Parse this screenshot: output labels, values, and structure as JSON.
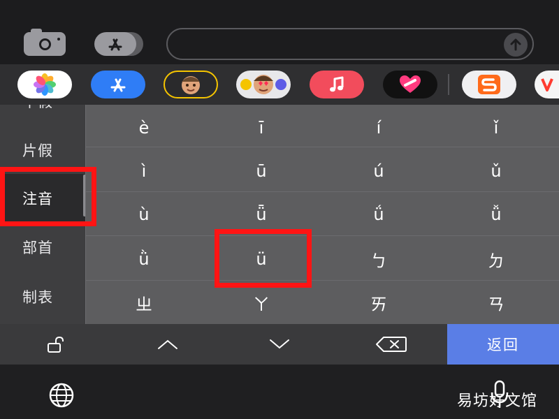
{
  "topbar": {
    "camera_icon": "camera-icon",
    "appstore_icon": "appstore-icon",
    "message_placeholder": "",
    "send_icon": "arrow-up-icon"
  },
  "app_strip": [
    {
      "name": "photos",
      "icon": "photos-icon",
      "bg": "#ffffff"
    },
    {
      "name": "app-store",
      "icon": "appstore-icon",
      "bg": "#2f7df6"
    },
    {
      "name": "memoji",
      "icon": "memoji-icon",
      "bg": "#3a3a3c"
    },
    {
      "name": "memoji-stickers",
      "icon": "memoji-stickers-icon",
      "bg": "#e8e8ea"
    },
    {
      "name": "music",
      "icon": "music-note-icon",
      "bg": "#f24c5c"
    },
    {
      "name": "digital-touch",
      "icon": "heart-icon",
      "bg": "#111111"
    },
    {
      "name": "sogou",
      "icon": "sogou-s-icon",
      "bg": "#f0f0f2"
    },
    {
      "name": "partial-app",
      "icon": "v-icon",
      "bg": "#f5f5f5"
    }
  ],
  "sidebar": {
    "items": [
      {
        "label": "平假"
      },
      {
        "label": "片假"
      },
      {
        "label": "注音"
      },
      {
        "label": "部首"
      },
      {
        "label": "制表"
      }
    ],
    "active_index": 2
  },
  "grid": {
    "rows": [
      [
        "è",
        "ī",
        "í",
        "ǐ"
      ],
      [
        "ì",
        "ū",
        "ú",
        "ǔ"
      ],
      [
        "ù",
        "ǖ",
        "ǘ",
        "ǚ"
      ],
      [
        "ǜ",
        "ü",
        "ㄅ",
        "ㄉ"
      ],
      [
        "ㄓ",
        "ㄚ",
        "ㄞ",
        "ㄢ"
      ]
    ]
  },
  "toolbar": {
    "lock_icon": "unlock-icon",
    "up_icon": "chevron-up-icon",
    "down_icon": "chevron-down-icon",
    "delete_icon": "backspace-icon",
    "return_label": "返回"
  },
  "bottom": {
    "globe_icon": "globe-icon",
    "mic_icon": "microphone-icon",
    "watermark": "易坊好文馆"
  },
  "colors": {
    "highlight": "#ff1414",
    "return_button": "#5a7ee6",
    "keyboard_bg": "#5d5d5f",
    "sidebar_bg": "#3e3e40"
  }
}
